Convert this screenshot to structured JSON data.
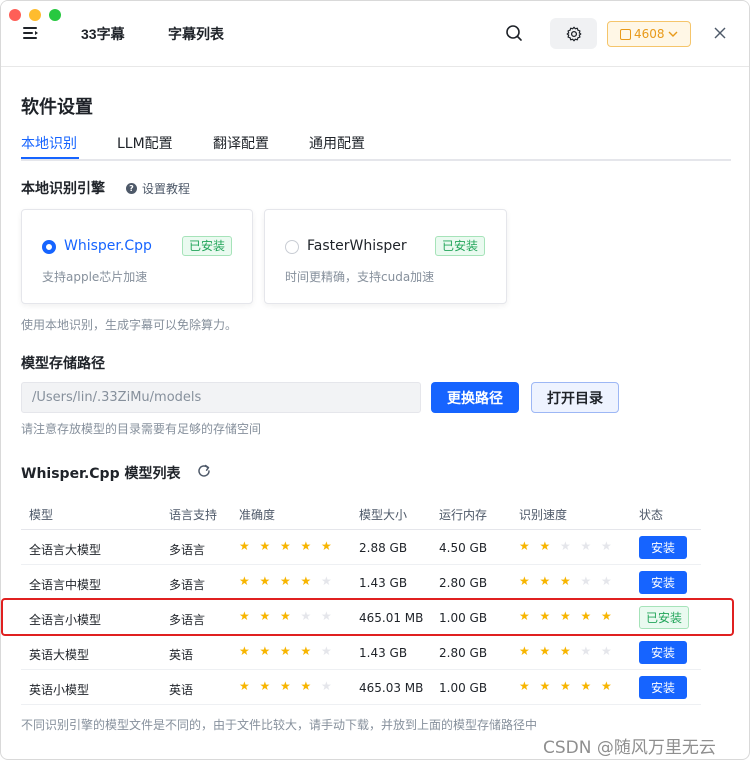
{
  "header": {
    "nav": [
      "33字幕",
      "字幕列表"
    ],
    "credits": "4608"
  },
  "page": {
    "title": "软件设置",
    "tabs": [
      "本地识别",
      "LLM配置",
      "翻译配置",
      "通用配置"
    ],
    "active_tab": "本地识别"
  },
  "engine_section": {
    "label": "本地识别引擎",
    "help": "设置教程",
    "engines": [
      {
        "name": "Whisper.Cpp",
        "status": "已安装",
        "desc": "支持apple芯片加速",
        "selected": true
      },
      {
        "name": "FasterWhisper",
        "status": "已安装",
        "desc": "时间更精确，支持cuda加速",
        "selected": false
      }
    ],
    "hint": "使用本地识别，生成字幕可以免除算力。"
  },
  "storage": {
    "label": "模型存储路径",
    "path_value": "/Users/lin/.33ZiMu/models",
    "change_btn": "更换路径",
    "open_btn": "打开目录",
    "hint": "请注意存放模型的目录需要有足够的存储空间"
  },
  "model_list": {
    "title": "Whisper.Cpp 模型列表",
    "columns": [
      "模型",
      "语言支持",
      "准确度",
      "模型大小",
      "运行内存",
      "识别速度",
      "状态"
    ],
    "rows": [
      {
        "name": "全语言大模型",
        "lang": "多语言",
        "accuracy": 5,
        "size": "2.88 GB",
        "memory": "4.50 GB",
        "speed": 2,
        "status": "安装"
      },
      {
        "name": "全语言中模型",
        "lang": "多语言",
        "accuracy": 4,
        "size": "1.43 GB",
        "memory": "2.80 GB",
        "speed": 3,
        "status": "安装"
      },
      {
        "name": "全语言小模型",
        "lang": "多语言",
        "accuracy": 3,
        "size": "465.01 MB",
        "memory": "1.00 GB",
        "speed": 5,
        "status": "已安装"
      },
      {
        "name": "英语大模型",
        "lang": "英语",
        "accuracy": 4,
        "size": "1.43 GB",
        "memory": "2.80 GB",
        "speed": 3,
        "status": "安装"
      },
      {
        "name": "英语小模型",
        "lang": "英语",
        "accuracy": 4,
        "size": "465.03 MB",
        "memory": "1.00 GB",
        "speed": 5,
        "status": "安装"
      }
    ],
    "footnote": "不同识别引擎的模型文件是不同的，由于文件比较大，请手动下载，并放到上面的模型存储路径中"
  },
  "watermark": "CSDN @随风万里无云",
  "colors": {
    "accent": "#1664ff",
    "installed": "#23a55a",
    "star": "#f7b500",
    "highlight": "#e02020"
  }
}
